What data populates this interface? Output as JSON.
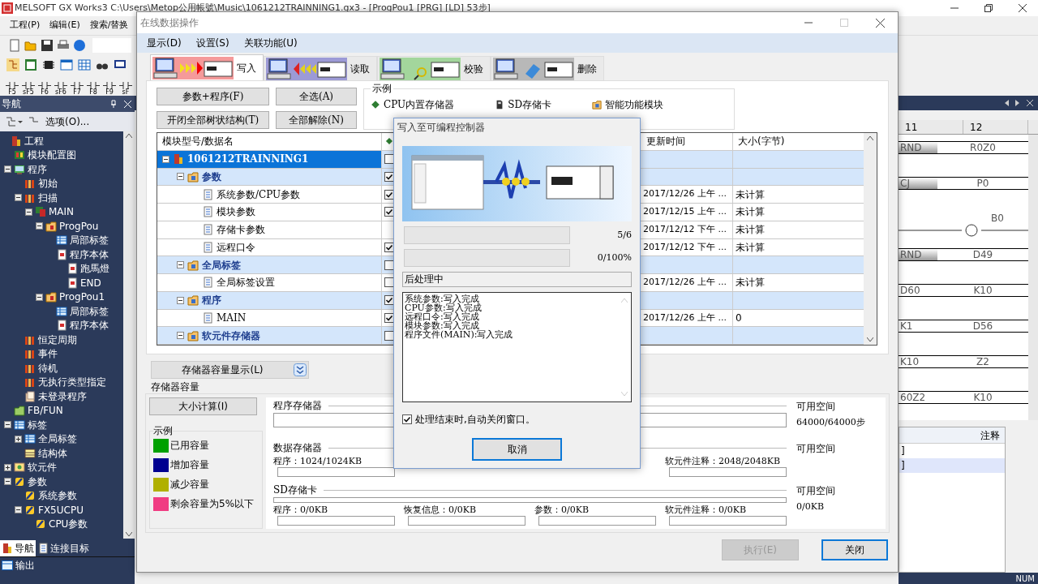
{
  "app": {
    "title": "MELSOFT GX Works3 C:\\Users\\Metop公用帳號\\Music\\1061212TRAINNING1.gx3 - [ProgPou1 [PRG] [LD] 53步]",
    "menu": [
      "工程(P)",
      "编辑(E)",
      "搜索/替换"
    ],
    "function_keys": [
      "F5",
      "sF5",
      "F6",
      "sF6",
      "F7",
      "F8",
      "F9",
      "sF"
    ]
  },
  "navigator": {
    "title": "导航",
    "options": "选项(O)...",
    "tree": [
      {
        "label": "工程",
        "kind": "project",
        "children": [
          {
            "label": "模块配置图",
            "kind": "module"
          },
          {
            "label": "程序",
            "kind": "folder",
            "expanded": true,
            "children": [
              {
                "label": "初始",
                "kind": "task"
              },
              {
                "label": "扫描",
                "kind": "task",
                "expanded": true,
                "children": [
                  {
                    "label": "MAIN",
                    "kind": "program",
                    "expanded": true,
                    "children": [
                      {
                        "label": "ProgPou",
                        "kind": "pou",
                        "expanded": true,
                        "children": [
                          {
                            "label": "局部标签",
                            "kind": "label"
                          },
                          {
                            "label": "程序本体",
                            "kind": "body",
                            "children": [
                              {
                                "label": "跑馬燈",
                                "kind": "body"
                              },
                              {
                                "label": "END",
                                "kind": "body"
                              }
                            ]
                          }
                        ]
                      },
                      {
                        "label": "ProgPou1",
                        "kind": "pou",
                        "expanded": true,
                        "children": [
                          {
                            "label": "局部标签",
                            "kind": "label"
                          },
                          {
                            "label": "程序本体",
                            "kind": "body"
                          }
                        ]
                      }
                    ]
                  }
                ]
              },
              {
                "label": "恒定周期",
                "kind": "task"
              },
              {
                "label": "事件",
                "kind": "task"
              },
              {
                "label": "待机",
                "kind": "task"
              },
              {
                "label": "无执行类型指定",
                "kind": "task"
              },
              {
                "label": "未登录程序",
                "kind": "pages"
              }
            ]
          },
          {
            "label": "FB/FUN",
            "kind": "fb"
          },
          {
            "label": "标签",
            "kind": "label",
            "expanded": true,
            "children": [
              {
                "label": "全局标签",
                "kind": "label",
                "expanded": false
              },
              {
                "label": "结构体",
                "kind": "struct"
              }
            ]
          },
          {
            "label": "软元件",
            "kind": "device",
            "expanded": false
          },
          {
            "label": "参数",
            "kind": "param",
            "expanded": true,
            "children": [
              {
                "label": "系统参数",
                "kind": "param"
              },
              {
                "label": "FX5UCPU",
                "kind": "param",
                "expanded": true,
                "children": [
                  {
                    "label": "CPU参数",
                    "kind": "param"
                  }
                ]
              }
            ]
          }
        ]
      }
    ]
  },
  "bottom_tabs": [
    {
      "label": "导航",
      "selected": true
    },
    {
      "label": "连接目标",
      "selected": false
    }
  ],
  "output_tab": "输出",
  "ladder": {
    "columns": [
      "11",
      "12"
    ],
    "rows": [
      {
        "kind": "instruction",
        "left": "RND",
        "right": "R0Z0"
      },
      {
        "kind": "instruction",
        "left": "CJ",
        "right": "P0"
      },
      {
        "kind": "coil",
        "right": "B0"
      },
      {
        "kind": "instruction",
        "left": "RND",
        "right": "D49"
      },
      {
        "kind": "operands",
        "left": "D60",
        "right": "K10"
      },
      {
        "kind": "operands",
        "left": "K1",
        "right": "D56"
      },
      {
        "kind": "operands",
        "left": "K10",
        "right": "Z2"
      },
      {
        "kind": "operands",
        "left": "60Z2",
        "right": "K10"
      }
    ]
  },
  "comment_table": {
    "header": "注释",
    "rows": [
      {
        "text": "]",
        "selected": false
      },
      {
        "text": "]",
        "selected": true
      }
    ]
  },
  "status_bar": {
    "text": "NUM"
  },
  "dialog": {
    "title": "在线数据操作",
    "menu": [
      "显示(D)",
      "设置(S)",
      "关联功能(U)"
    ],
    "tabs": [
      {
        "label": "写入",
        "kind": "write",
        "color": "#f59a9a",
        "selected": true
      },
      {
        "label": "读取",
        "kind": "read",
        "color": "#9c9ad6",
        "selected": false
      },
      {
        "label": "校验",
        "kind": "verify",
        "color": "#a3d69c",
        "selected": false
      },
      {
        "label": "删除",
        "kind": "delete",
        "color": "#b8b8b8",
        "selected": false
      }
    ],
    "buttons": [
      "参数+程序(F)",
      "全选(A)",
      "开闭全部树状结构(T)",
      "全部解除(N)"
    ],
    "legend": {
      "title": "示例",
      "items": [
        {
          "kind": "cpu",
          "label": "CPU内置存储器"
        },
        {
          "kind": "sd",
          "label": "SD存储卡"
        },
        {
          "kind": "module",
          "label": "智能功能模块"
        }
      ]
    },
    "table": {
      "columns": [
        "模块型号/数据名",
        "更新时间",
        "大小(字节)"
      ],
      "rows": [
        {
          "name": "1061212TRAINNING1",
          "kind": "project",
          "checked": false,
          "selected": true,
          "expanded": true,
          "children": [
            {
              "name": "参数",
              "kind": "group",
              "checked": true,
              "selected": false,
              "expanded": true,
              "children": [
                {
                  "name": "系统参数/CPU参数",
                  "kind": "item",
                  "checked": true,
                  "selected": false,
                  "updated": "2017/12/26 上午 ...",
                  "size": "未计算"
                },
                {
                  "name": "模块参数",
                  "kind": "item",
                  "checked": true,
                  "selected": false,
                  "updated": "2017/12/15 上午 ...",
                  "size": "未计算"
                },
                {
                  "name": "存储卡参数",
                  "kind": "item",
                  "selected": false,
                  "updated": "2017/12/12 下午 ...",
                  "size": "未计算"
                },
                {
                  "name": "远程口令",
                  "kind": "item",
                  "checked": true,
                  "selected": false,
                  "updated": "2017/12/12 下午 ...",
                  "size": "未计算"
                }
              ]
            },
            {
              "name": "全局标签",
              "kind": "group",
              "checked": false,
              "selected": false,
              "expanded": true,
              "children": [
                {
                  "name": "全局标签设置",
                  "kind": "item",
                  "checked": false,
                  "selected": false,
                  "updated": "2017/12/26 上午 ...",
                  "size": "未计算"
                }
              ]
            },
            {
              "name": "程序",
              "kind": "group",
              "checked": true,
              "selected": false,
              "expanded": true,
              "children": [
                {
                  "name": "MAIN",
                  "kind": "item",
                  "checked": true,
                  "selected": false,
                  "updated": "2017/12/26 上午 ...",
                  "size": "0"
                }
              ]
            },
            {
              "name": "软元件存储器",
              "kind": "group",
              "checked": false,
              "selected": false,
              "expanded": true
            }
          ]
        }
      ]
    },
    "memory_toggle": "存储器容量显示(L)",
    "memory": {
      "title": "存储器容量",
      "calc_button": "大小计算(I)",
      "legend_title": "示例",
      "legend": [
        {
          "label": "已用容量",
          "color": "#00a000"
        },
        {
          "label": "增加容量",
          "color": "#000090"
        },
        {
          "label": "减少容量",
          "color": "#b0b000"
        },
        {
          "label": "剩余容量为5%以下",
          "color": "#f03c82"
        }
      ],
      "sections": [
        {
          "title": "程序存储器",
          "total_bar": true,
          "free_label": "可用空间",
          "free": "64000/64000步"
        },
        {
          "title": "数据存储器",
          "total_bar": false,
          "free_label": "可用空间",
          "parts": [
            {
              "label": "程序：1024/1024KB"
            },
            {
              "label": "软元件注释：2048/2048KB"
            }
          ]
        },
        {
          "title": "SD存储卡",
          "total_bar": true,
          "free_label": "可用空间",
          "free": "0/0KB",
          "parts": [
            {
              "label": "程序：0/0KB"
            },
            {
              "label": "恢复信息：0/0KB"
            },
            {
              "label": "参数：0/0KB"
            },
            {
              "label": "软元件注释：0/0KB"
            }
          ]
        }
      ]
    },
    "footer_buttons": [
      {
        "label": "执行(E)",
        "disabled": true
      },
      {
        "label": "关闭",
        "disabled": false
      }
    ]
  },
  "progress": {
    "title": "写入至可编程控制器",
    "bars": [
      {
        "reading": "5/6"
      },
      {
        "reading": "0/100%"
      }
    ],
    "status": "后处理中",
    "log": [
      "系统参数:写入完成",
      "CPU参数:写入完成",
      "远程口令:写入完成",
      "模块参数:写入完成",
      "程序文件(MAIN):写入完成"
    ],
    "auto_close": {
      "label": "处理结束时,自动关闭窗口。",
      "checked": true
    },
    "cancel": "取消"
  }
}
